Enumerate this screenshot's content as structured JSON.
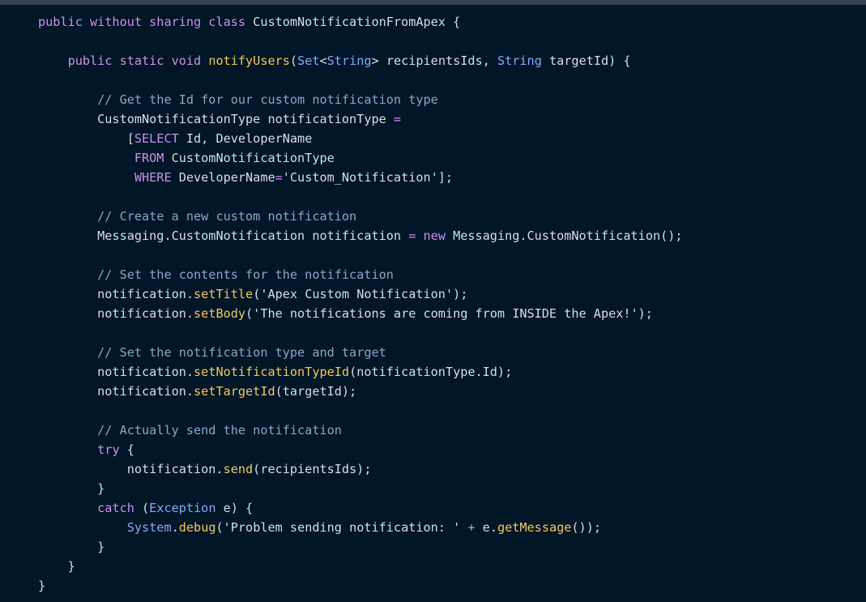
{
  "colors": {
    "background": "#011627",
    "keyword": "#c792ea",
    "function": "#f2c85b",
    "type": "#82aaff",
    "comment": "#8fa4c9",
    "text": "#d6deeb"
  },
  "lines": [
    [
      [
        "kw",
        "public without sharing class "
      ],
      [
        "pl",
        "CustomNotificationFromApex {"
      ]
    ],
    [],
    [
      [
        "pl",
        "    "
      ],
      [
        "kw",
        "public static void "
      ],
      [
        "fn",
        "notifyUsers"
      ],
      [
        "pl",
        "("
      ],
      [
        "ty",
        "Set"
      ],
      [
        "pl",
        "<"
      ],
      [
        "ty",
        "String"
      ],
      [
        "pl",
        "> recipientsIds, "
      ],
      [
        "ty",
        "String"
      ],
      [
        "pl",
        " targetId) {"
      ]
    ],
    [],
    [
      [
        "pl",
        "        "
      ],
      [
        "cm",
        "// Get the Id for our custom notification type"
      ]
    ],
    [
      [
        "pl",
        "        CustomNotificationType notificationType "
      ],
      [
        "op",
        "="
      ]
    ],
    [
      [
        "pl",
        "            ["
      ],
      [
        "kw",
        "SELECT"
      ],
      [
        "pl",
        " Id, DeveloperName"
      ]
    ],
    [
      [
        "pl",
        "             "
      ],
      [
        "kw",
        "FROM"
      ],
      [
        "pl",
        " CustomNotificationType"
      ]
    ],
    [
      [
        "pl",
        "             "
      ],
      [
        "kw",
        "WHERE"
      ],
      [
        "pl",
        " DeveloperName"
      ],
      [
        "op",
        "="
      ],
      [
        "pl",
        "'Custom_Notification'];"
      ]
    ],
    [],
    [
      [
        "pl",
        "        "
      ],
      [
        "cm",
        "// Create a new custom notification"
      ]
    ],
    [
      [
        "pl",
        "        Messaging.CustomNotification notification "
      ],
      [
        "op",
        "="
      ],
      [
        "pl",
        " "
      ],
      [
        "kw",
        "new"
      ],
      [
        "pl",
        " Messaging.CustomNotification();"
      ]
    ],
    [],
    [
      [
        "pl",
        "        "
      ],
      [
        "cm",
        "// Set the contents for the notification"
      ]
    ],
    [
      [
        "pl",
        "        notification."
      ],
      [
        "fn",
        "setTitle"
      ],
      [
        "pl",
        "('Apex Custom Notification');"
      ]
    ],
    [
      [
        "pl",
        "        notification."
      ],
      [
        "fn",
        "setBody"
      ],
      [
        "pl",
        "('The notifications are coming from INSIDE the Apex!');"
      ]
    ],
    [],
    [
      [
        "pl",
        "        "
      ],
      [
        "cm",
        "// Set the notification type and target"
      ]
    ],
    [
      [
        "pl",
        "        notification."
      ],
      [
        "fn",
        "setNotificationTypeId"
      ],
      [
        "pl",
        "(notificationType.Id);"
      ]
    ],
    [
      [
        "pl",
        "        notification."
      ],
      [
        "fn",
        "setTargetId"
      ],
      [
        "pl",
        "(targetId);"
      ]
    ],
    [],
    [
      [
        "pl",
        "        "
      ],
      [
        "cm",
        "// Actually send the notification"
      ]
    ],
    [
      [
        "pl",
        "        "
      ],
      [
        "kw",
        "try"
      ],
      [
        "pl",
        " {"
      ]
    ],
    [
      [
        "pl",
        "            notification."
      ],
      [
        "fn",
        "send"
      ],
      [
        "pl",
        "(recipientsIds);"
      ]
    ],
    [
      [
        "pl",
        "        }"
      ]
    ],
    [
      [
        "pl",
        "        "
      ],
      [
        "kw",
        "catch"
      ],
      [
        "pl",
        " ("
      ],
      [
        "ty",
        "Exception"
      ],
      [
        "pl",
        " e) {"
      ]
    ],
    [
      [
        "pl",
        "            "
      ],
      [
        "ty",
        "System"
      ],
      [
        "pl",
        "."
      ],
      [
        "fn",
        "debug"
      ],
      [
        "pl",
        "('Problem sending notification: ' "
      ],
      [
        "op",
        "+"
      ],
      [
        "pl",
        " e."
      ],
      [
        "fn",
        "getMessage"
      ],
      [
        "pl",
        "());"
      ]
    ],
    [
      [
        "pl",
        "        }"
      ]
    ],
    [
      [
        "pl",
        "    }"
      ]
    ],
    [
      [
        "pl",
        "}"
      ]
    ]
  ]
}
